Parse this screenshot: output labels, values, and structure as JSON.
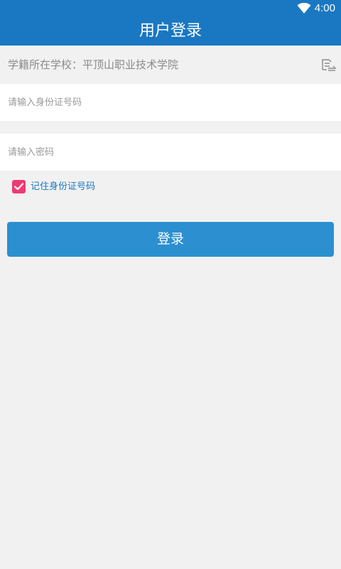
{
  "status_bar": {
    "time": "4:00",
    "wifi_icon": "wifi-icon"
  },
  "header": {
    "title": "用户登录"
  },
  "school": {
    "text": "学籍所在学校：平顶山职业技术学院",
    "switch_icon": "switch-school-icon"
  },
  "form": {
    "id_placeholder": "请输入身份证号码",
    "password_placeholder": "请输入密码",
    "remember_label": "记住身份证号码",
    "remember_checked": true
  },
  "login_button": {
    "label": "登录"
  },
  "colors": {
    "primary": "#1a78c2",
    "button": "#2b8fd0",
    "checkbox": "#ee3a73",
    "background": "#f1f1f1"
  }
}
